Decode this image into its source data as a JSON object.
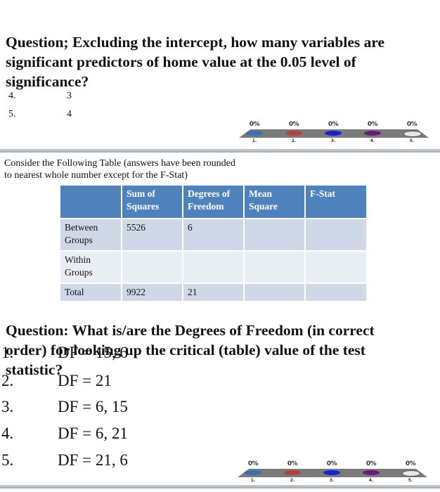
{
  "slide1": {
    "question_lines": [
      "Question; Excluding the intercept, how many variables are",
      "significant predictors of home value at the 0.05 level of",
      "significance?"
    ],
    "options": [
      {
        "num": "4.",
        "text": "3"
      },
      {
        "num": "5.",
        "text": "4"
      }
    ],
    "poll": {
      "percents": [
        "0%",
        "0%",
        "0%",
        "0%",
        "0%"
      ],
      "labels": [
        "1.",
        "2.",
        "3.",
        "4.",
        "5."
      ],
      "colors": [
        "#3b6fb0",
        "#b0443c",
        "#1a1fd6",
        "#6a1b7a",
        "#e6e6e6"
      ]
    }
  },
  "slide2": {
    "intro_lines": [
      "Consider the Following Table (answers have been rounded",
      "to nearest whole number except for the F-Stat)"
    ],
    "table": {
      "headers": [
        "",
        "Sum of Squares",
        "Degrees of Freedom",
        "Mean Square",
        "F-Stat"
      ],
      "rows": [
        [
          "Between Groups",
          "5526",
          "6",
          "",
          ""
        ],
        [
          "Within Groups",
          "",
          "",
          "",
          ""
        ],
        [
          "Total",
          "9922",
          "21",
          "",
          ""
        ]
      ]
    },
    "question_lines": [
      "Question: What is/are the Degrees of Freedom (in correct",
      "order) for looking up the critical (table) value of the test",
      "statistic?"
    ],
    "options": [
      {
        "num": "1.",
        "text": "DF = 15, 6"
      },
      {
        "num": "2.",
        "text": "DF = 21"
      },
      {
        "num": "3.",
        "text": "DF = 6, 15"
      },
      {
        "num": "4.",
        "text": "DF = 6, 21"
      },
      {
        "num": "5.",
        "text": "DF = 21, 6"
      }
    ],
    "poll": {
      "percents": [
        "0%",
        "0%",
        "0%",
        "0%",
        "0%"
      ],
      "labels": [
        "1.",
        "2.",
        "3.",
        "4.",
        "5."
      ],
      "colors": [
        "#3b6fb0",
        "#b0443c",
        "#1a1fd6",
        "#6a1b7a",
        "#e6e6e6"
      ]
    }
  },
  "theme": {
    "table_header": "#4f81bd",
    "row_dark": "#d0d8e8",
    "row_light": "#e9edf4"
  }
}
